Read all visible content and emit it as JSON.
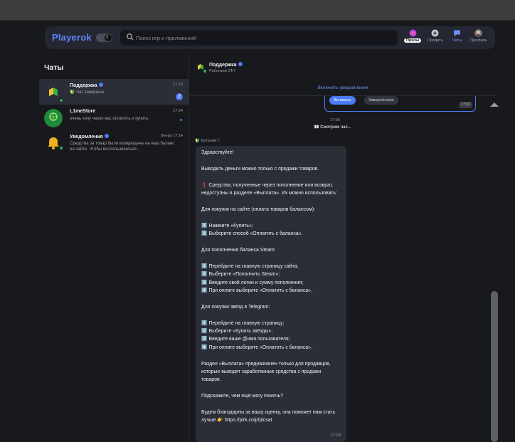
{
  "header": {
    "logo": "Playerok",
    "search_placeholder": "Поиск игр и приложений",
    "nav": [
      {
        "label": "Призы",
        "icon": "prizes-icon"
      },
      {
        "label": "Продать",
        "icon": "plus-circle-icon"
      },
      {
        "label": "Чаты",
        "icon": "chat-icon"
      },
      {
        "label": "Профиль",
        "icon": "avatar-icon"
      }
    ]
  },
  "sidebar": {
    "title": "Чаты",
    "chats": [
      {
        "name": "Поддержка",
        "time": "17:13",
        "preview": "🔰 Чат завершен",
        "badge": "2"
      },
      {
        "name": "L1meStore",
        "time": "17:04",
        "preview": "очень хочу через вас оплатить и купить"
      },
      {
        "name": "Уведомления",
        "time": "Вчера 17:14",
        "preview": "Средства за товар были возвращены на ваш баланс на сайте. Чтобы воспользоваться..."
      }
    ]
  },
  "conversation": {
    "title": "Поддержка",
    "subtitle": "Работаем 24/7",
    "notify_label": "Включить уведомления",
    "card": {
      "tab_active": "Активные",
      "tab_done": "Завершённые",
      "time": "17:02"
    },
    "time_top": "17:09",
    "viewing": "👀 Смотрим чат...",
    "sender": "Виталий Г.",
    "message": "Здравствуйте!\n\nВыводить деньги можно только с продажи товаров.\n\n❗ Средства, полученные через пополнение или возврат, недоступны в разделе «Выплата». Их можно использовать:\n\nДля покупок на сайте (оплата товаров балансом):\n\n1️⃣ Нажмите «Купить»;\n2️⃣ Выберите способ «Оплатить с баланса».\n\nДля пополнения баланса Steam:\n\n1️⃣ Перейдите на главную страницу сайта;\n2️⃣ Выберите «Пополнить Steam»;\n3️⃣ Введите свой логин и сумму пополнения;\n4️⃣ При оплате выберите «Оплатить с баланса».\n\nДля покупки звёзд в Telegram:\n\n1️⃣ Перейдите на главную страницу;\n2️⃣ Выберите «Купить звёзды»;\n3️⃣ Введите ваше @имя пользователя;\n4️⃣ При оплате выберите «Оплатить с баланса».\n\nРаздел «Выплата» предназначен только для продавцов, которые выводят заработанные средства с продажи товаров.\n\nПодскажите, чем ещё могу помочь?\n\nБудем благодарны за вашу оценку, она поможет нам стать лучше 👉 https://pirk.co/p/plcsat",
    "message_time": "17:09"
  },
  "colors": {
    "accent": "#4c7cf2",
    "online": "#29b35b",
    "background": "#18191d"
  }
}
